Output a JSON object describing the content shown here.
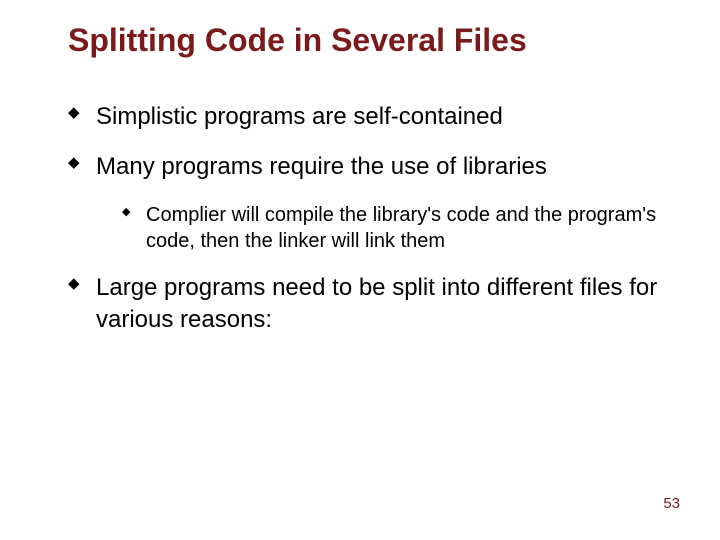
{
  "title": "Splitting Code in Several Files",
  "bullets": {
    "b1": "Simplistic programs are self-contained",
    "b2": "Many programs require the use of libraries",
    "b2_1": "Complier will compile the library's code and the program's code, then the linker will link them",
    "b3": "Large programs need to be split into different files for various reasons:"
  },
  "page_number": "53"
}
